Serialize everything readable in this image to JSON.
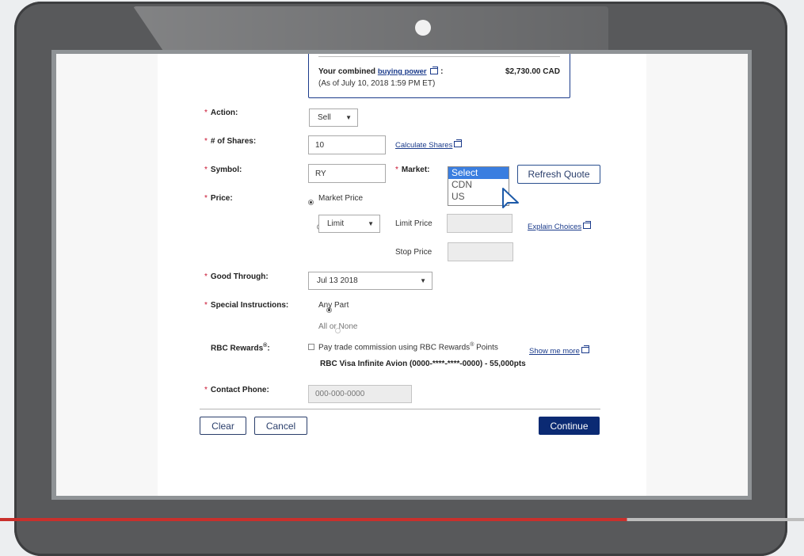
{
  "buying_power": {
    "prefix": "Your combined",
    "link": "buying power",
    "suffix": ":",
    "amount": "$2,730.00 CAD",
    "as_of": "(As of July 10, 2018 1:59 PM ET)"
  },
  "required_mark": "*",
  "action": {
    "label": "Action:",
    "value": "Sell"
  },
  "shares": {
    "label": "# of Shares:",
    "value": "10",
    "calc_link": "Calculate Shares"
  },
  "symbol": {
    "label": "Symbol:",
    "value": "RY"
  },
  "market": {
    "label": "Market:",
    "options": [
      "Select",
      "CDN",
      "US"
    ],
    "selected": "Select"
  },
  "refresh_button": "Refresh Quote",
  "price": {
    "label": "Price:",
    "market_price": "Market Price",
    "limit_select": "Limit",
    "limit_price_label": "Limit Price",
    "stop_price_label": "Stop Price",
    "explain_link": "Explain Choices"
  },
  "good_through": {
    "label": "Good Through:",
    "value": "Jul 13 2018"
  },
  "special": {
    "label": "Special Instructions:",
    "any_part": "Any Part",
    "all_or_none": "All or None"
  },
  "rewards": {
    "label_main": "RBC Rewards",
    "label_sup": "®",
    "label_end": ":",
    "text_main": "Pay trade commission using RBC Rewards",
    "text_sup": "®",
    "text_end": " Points",
    "show_more": "Show me more",
    "card": "RBC Visa Infinite Avion (0000-****-****-0000) - 55,000pts"
  },
  "phone": {
    "label": "Contact Phone:",
    "placeholder": "000-000-0000"
  },
  "buttons": {
    "clear": "Clear",
    "cancel": "Cancel",
    "continue": "Continue"
  }
}
